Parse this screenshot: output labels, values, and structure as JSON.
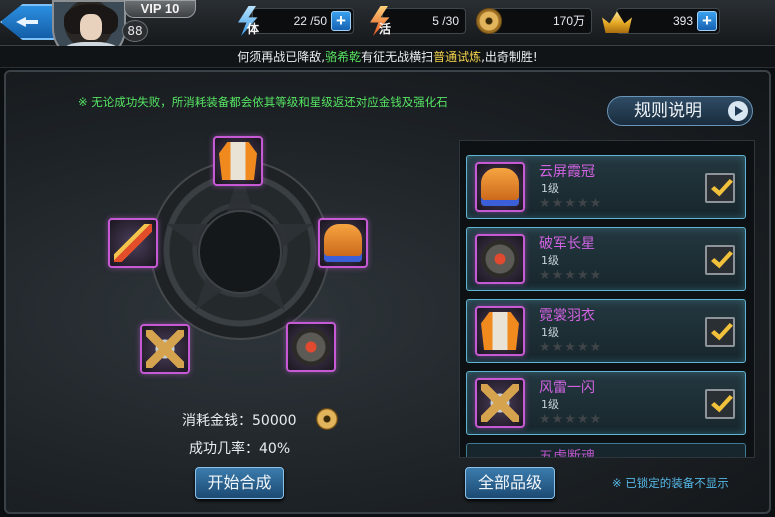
{
  "header": {
    "vip": "VIP 10",
    "level": "88",
    "stamina": {
      "tag": "体",
      "value": "22 /50"
    },
    "activity": {
      "tag": "活",
      "value": "5 /30"
    },
    "coins": {
      "value": "170万"
    },
    "ingots": {
      "value": "393"
    },
    "plus": "+"
  },
  "ticker": {
    "part1": "何须再战已降敌,",
    "name": "骆希乾",
    "part2": "有征无战横扫",
    "mode": "普通试炼",
    "part3": ",出奇制胜!"
  },
  "notice": "※ 无论成功失败，所消耗装备都会依其等级和星级返还对应金钱及强化石",
  "rules_button": "规则说明",
  "cost": {
    "label": "消耗金钱：50000"
  },
  "rate": {
    "label": "成功几率：40%"
  },
  "start_button": "开始合成",
  "all_grades_button": "全部品级",
  "hint": "※ 已锁定的装备不显示",
  "equipment_list": [
    {
      "name": "云屏霞冠",
      "level": "1级",
      "stars": "★★★★★",
      "icon": "crown-icon",
      "checked": true
    },
    {
      "name": "破军长星",
      "level": "1级",
      "stars": "★★★★★",
      "icon": "mace-icon",
      "checked": true
    },
    {
      "name": "霓裳羽衣",
      "level": "1级",
      "stars": "★★★★★",
      "icon": "robe-icon",
      "checked": true
    },
    {
      "name": "风雷一闪",
      "level": "1级",
      "stars": "★★★★★",
      "icon": "axe-icon",
      "checked": true
    },
    {
      "name": "五虎断魂",
      "level": "",
      "stars": "",
      "icon": "",
      "checked": false
    }
  ],
  "colors": {
    "accent_purple": "#c65ad4",
    "text_green": "#56e463",
    "text_blue": "#56b7e6",
    "check_gold": "#f2c13c"
  }
}
